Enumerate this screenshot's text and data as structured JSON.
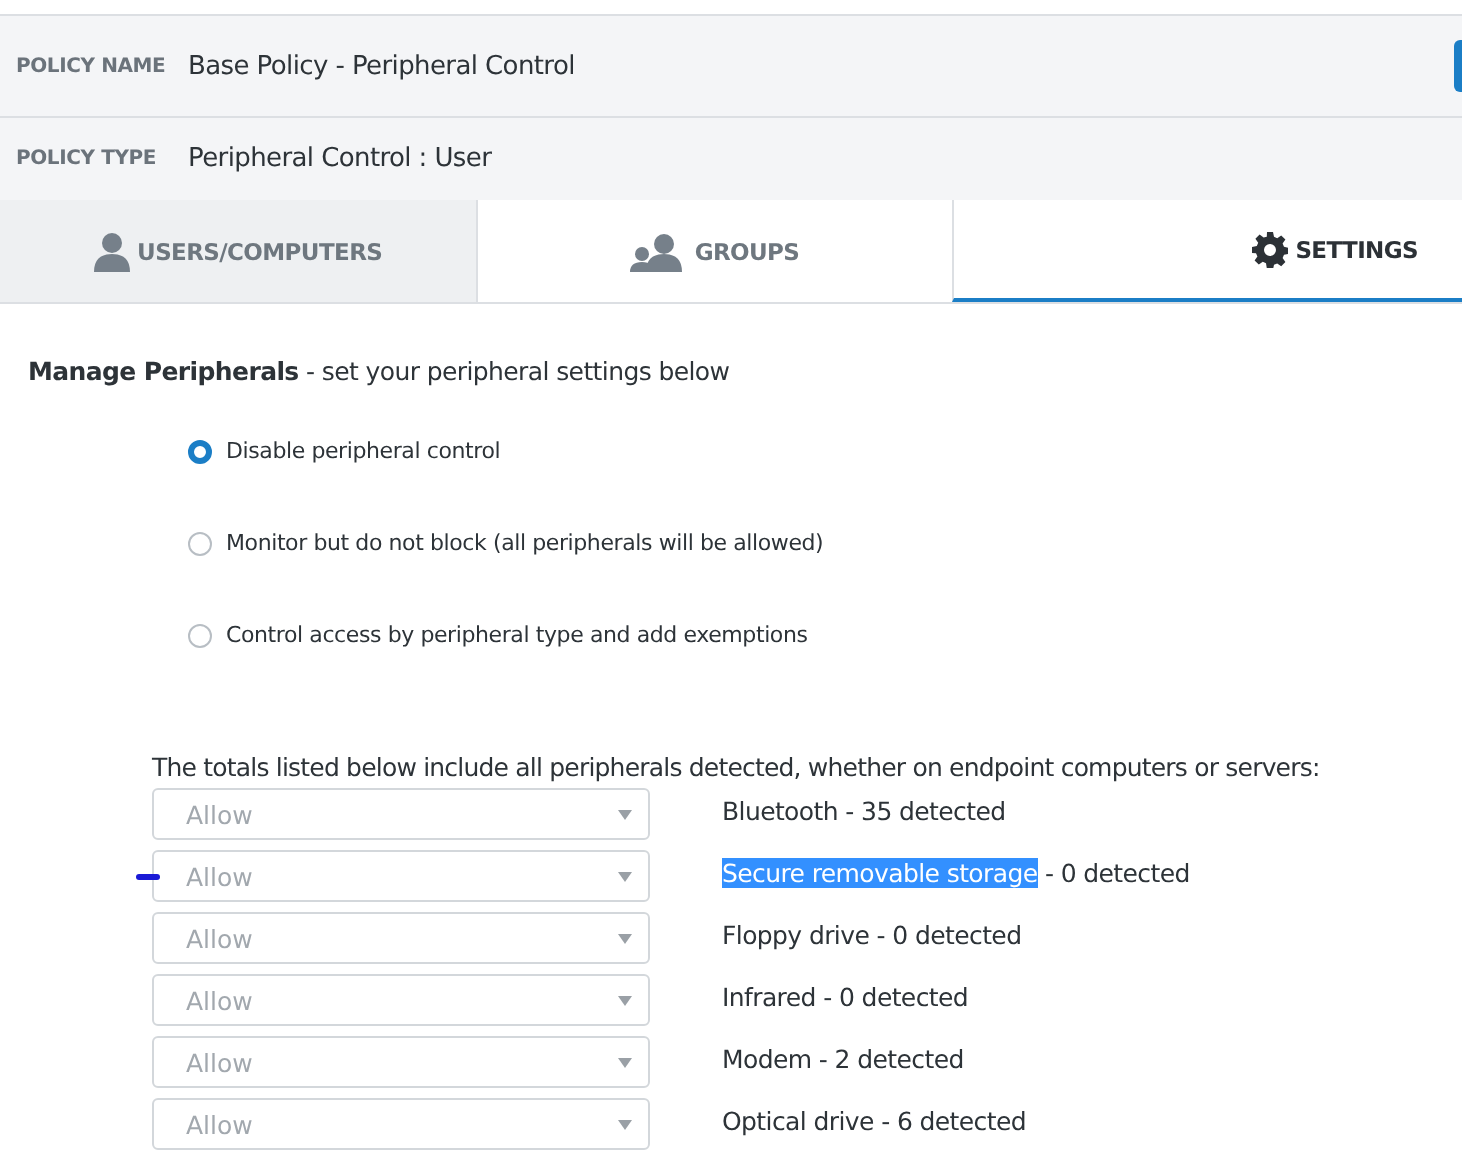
{
  "policy": [
    {
      "label": "POLICY NAME",
      "value": "Base Policy - Peripheral Control"
    },
    {
      "label": "POLICY TYPE",
      "value": "Peripheral Control : User"
    }
  ],
  "tabs": [
    {
      "label": "USERS/COMPUTERS",
      "shaded": true,
      "selected": false
    },
    {
      "label": "GROUPS",
      "shaded": false,
      "selected": false
    },
    {
      "label": "SETTINGS",
      "shaded": false,
      "selected": true
    }
  ],
  "heading": {
    "title": "Manage Peripherals",
    "text": "- set your peripheral settings below"
  },
  "options": [
    {
      "label": "Disable peripheral control",
      "selected": true
    },
    {
      "label": "Monitor but do not block (all peripherals will be allowed)",
      "selected": false
    },
    {
      "label": "Control access by peripheral type and add exemptions",
      "selected": false
    }
  ],
  "totals_note": "The totals listed below include all peripherals detected, whether on endpoint computers or servers:",
  "peripherals": [
    {
      "setting": "Allow",
      "name": "Bluetooth",
      "detail": "- 35 detected",
      "highlighted": false,
      "pen_mark": false
    },
    {
      "setting": "Allow",
      "name": "Secure removable storage",
      "detail": "- 0 detected",
      "highlighted": true,
      "pen_mark": true
    },
    {
      "setting": "Allow",
      "name": "Floppy drive",
      "detail": "- 0 detected",
      "highlighted": false,
      "pen_mark": false
    },
    {
      "setting": "Allow",
      "name": "Infrared",
      "detail": "- 0 detected",
      "highlighted": false,
      "pen_mark": false
    },
    {
      "setting": "Allow",
      "name": "Modem",
      "detail": "- 2 detected",
      "highlighted": false,
      "pen_mark": false
    },
    {
      "setting": "Allow",
      "name": "Optical drive",
      "detail": "- 6 detected",
      "highlighted": false,
      "pen_mark": false
    }
  ]
}
